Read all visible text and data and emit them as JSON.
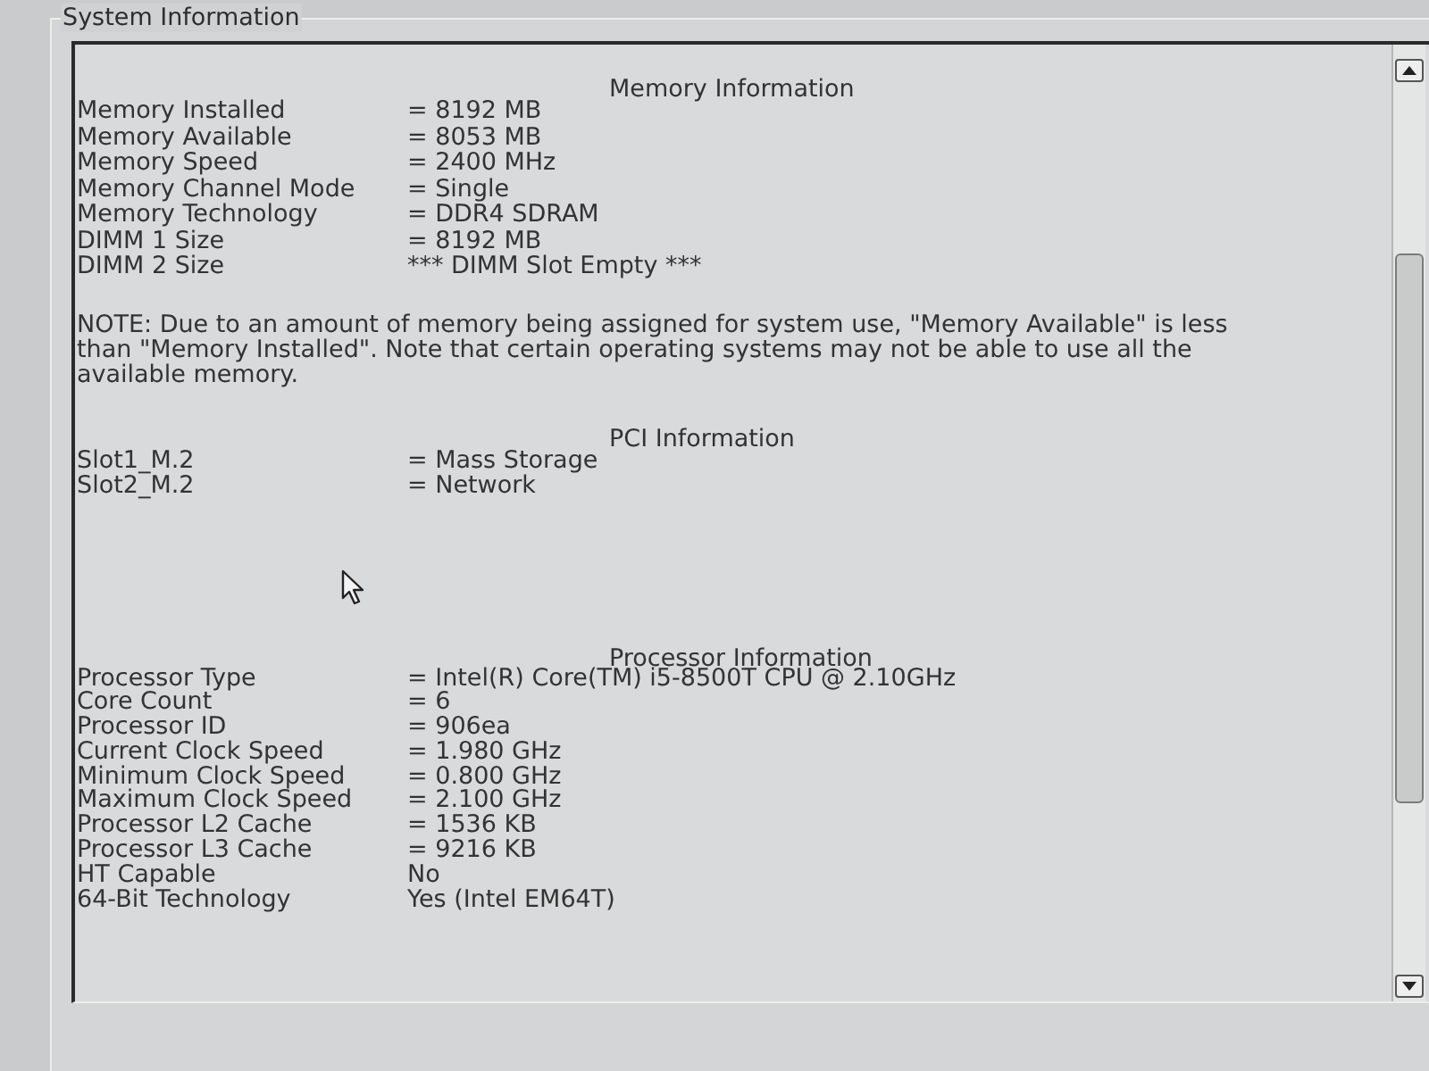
{
  "group_box": {
    "title": "System Information"
  },
  "sections": [
    {
      "heading": "Memory Information",
      "rows": [
        {
          "label": "Memory Installed",
          "value": "= 8192 MB"
        },
        {
          "label": "Memory Available",
          "value": "= 8053 MB"
        },
        {
          "label": "Memory Speed",
          "value": "= 2400 MHz"
        },
        {
          "label": "Memory Channel Mode",
          "value": "= Single"
        },
        {
          "label": "Memory Technology",
          "value": "= DDR4 SDRAM"
        },
        {
          "label": "DIMM 1 Size",
          "value": "= 8192 MB"
        },
        {
          "label": "DIMM 2 Size",
          "value": "*** DIMM Slot Empty ***"
        }
      ],
      "note": "NOTE: Due to an amount of memory being assigned for system use, \"Memory Available\" is less than \"Memory Installed\". Note that certain operating systems may not be able to use all the available memory."
    },
    {
      "heading": "PCI Information",
      "rows": [
        {
          "label": "Slot1_M.2",
          "value": "= Mass Storage"
        },
        {
          "label": "Slot2_M.2",
          "value": "= Network"
        }
      ]
    },
    {
      "heading": "Processor Information",
      "rows": [
        {
          "label": "Processor Type",
          "value": "= Intel(R) Core(TM) i5-8500T CPU @ 2.10GHz"
        },
        {
          "label": "Core Count",
          "value": "= 6"
        },
        {
          "label": "Processor ID",
          "value": "= 906ea"
        },
        {
          "label": "Current Clock Speed",
          "value": "= 1.980 GHz"
        },
        {
          "label": "Minimum Clock Speed",
          "value": "= 0.800 GHz"
        },
        {
          "label": "Maximum Clock Speed",
          "value": "= 2.100 GHz"
        },
        {
          "label": "Processor L2 Cache",
          "value": "= 1536 KB"
        },
        {
          "label": "Processor L3 Cache",
          "value": "= 9216 KB"
        },
        {
          "label": "HT Capable",
          "value": "No"
        },
        {
          "label": "64-Bit Technology",
          "value": "Yes (Intel EM64T)"
        }
      ]
    }
  ]
}
